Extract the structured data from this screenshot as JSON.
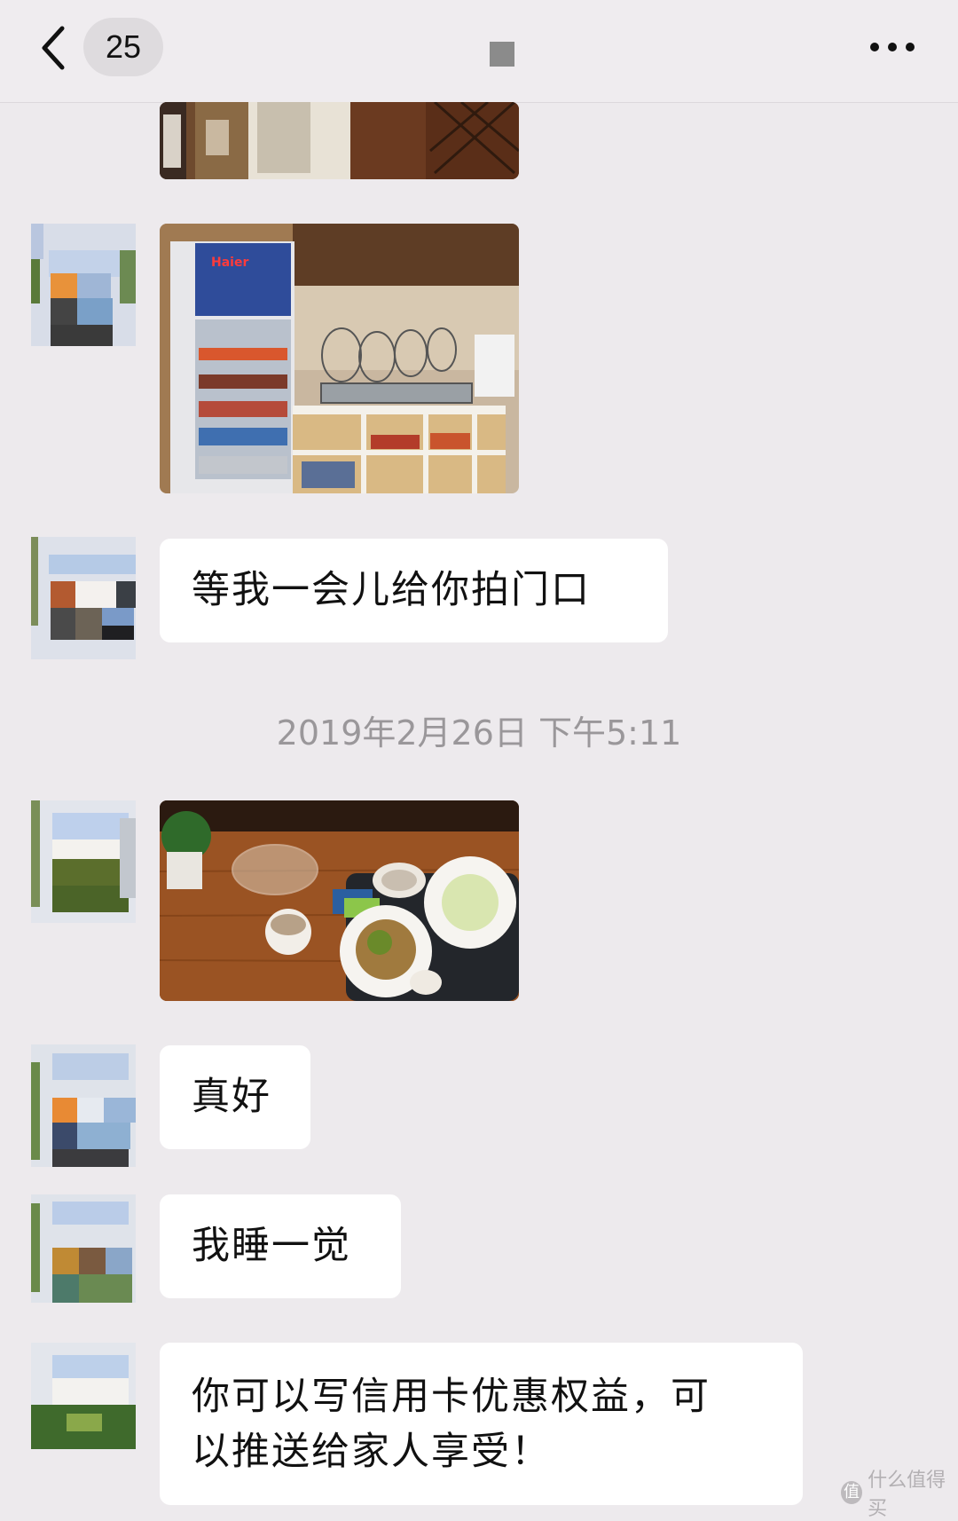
{
  "header": {
    "unread_count": "25",
    "back_icon": "chevron-left-icon",
    "more_icon": "more-horizontal-icon"
  },
  "messages": [
    {
      "type": "image",
      "depicts": "hotel lounge entrance (partially scrolled)"
    },
    {
      "type": "image",
      "depicts": "buffet counter with Haier fridge"
    },
    {
      "type": "text",
      "text": "等我一会儿给你拍门口"
    },
    {
      "type": "timestamp",
      "text": "2019年2月26日 下午5:11"
    },
    {
      "type": "image",
      "depicts": "table with food plates"
    },
    {
      "type": "text",
      "text": "真好"
    },
    {
      "type": "text",
      "text": "我睡一觉"
    },
    {
      "type": "text",
      "lines": [
        "你可以写信用卡优惠权益，可",
        "以推送给家人享受！"
      ]
    }
  ],
  "fridge_brand": "Haier",
  "watermark": {
    "text": "什么值得买",
    "icon_glyph": "值"
  },
  "colors": {
    "background": "#edeaed",
    "bubble": "#ffffff",
    "timestamp": "#9a979a"
  }
}
